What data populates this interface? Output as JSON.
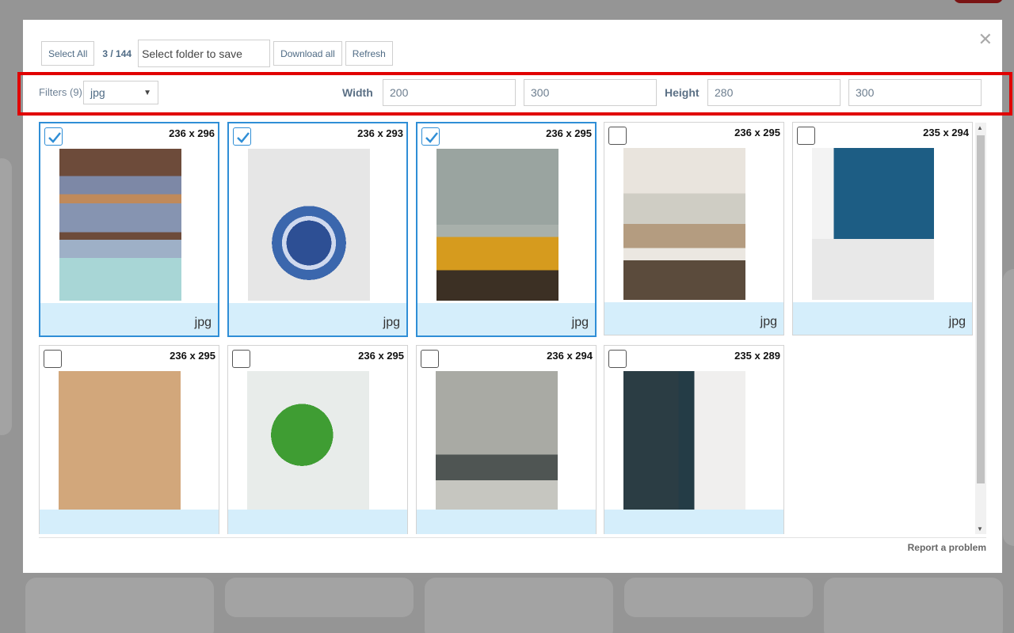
{
  "toolbar": {
    "select_all_label": "Select All",
    "count": "3 / 144",
    "folder_placeholder": "Select folder to save",
    "download_all_label": "Download all",
    "refresh_label": "Refresh",
    "close_icon": "close-icon"
  },
  "filters": {
    "label": "Filters (9)",
    "type_value": "jpg",
    "width_label": "Width",
    "width_min": "200",
    "width_max": "300",
    "height_label": "Height",
    "height_min": "280",
    "height_max": "300"
  },
  "images": [
    {
      "dims": "236 x 296",
      "ext": "jpg",
      "selected": true
    },
    {
      "dims": "236 x 293",
      "ext": "jpg",
      "selected": true
    },
    {
      "dims": "236 x 295",
      "ext": "jpg",
      "selected": true
    },
    {
      "dims": "236 x 295",
      "ext": "jpg",
      "selected": false
    },
    {
      "dims": "235 x 294",
      "ext": "jpg",
      "selected": false
    },
    {
      "dims": "236 x 295",
      "ext": "",
      "selected": false
    },
    {
      "dims": "236 x 295",
      "ext": "",
      "selected": false
    },
    {
      "dims": "236 x 294",
      "ext": "",
      "selected": false
    },
    {
      "dims": "235 x 289",
      "ext": "",
      "selected": false
    }
  ],
  "footer": {
    "report_label": "Report a problem"
  },
  "colors": {
    "accent": "#2f8ed6",
    "highlight_outline": "#e10000",
    "card_footer": "#d5eefb"
  }
}
